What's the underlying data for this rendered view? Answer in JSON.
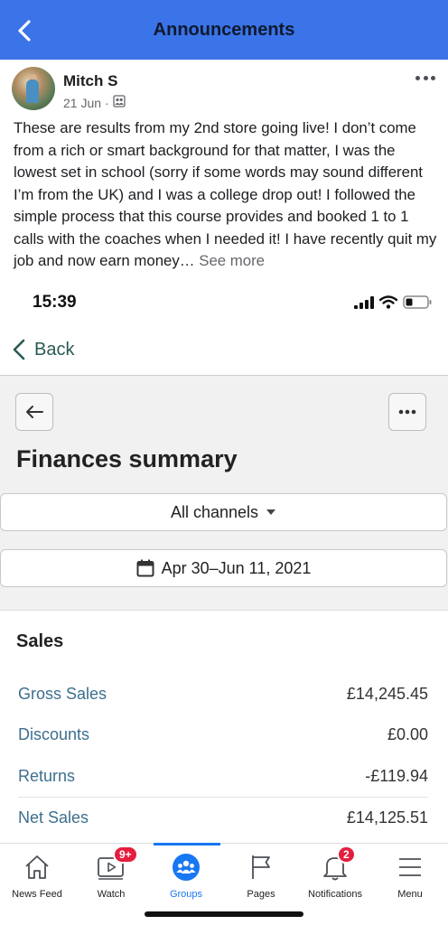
{
  "header": {
    "title": "Announcements",
    "back_icon": "chevron-left-icon",
    "background_color": "#3b73e8"
  },
  "post": {
    "author": "Mitch S",
    "date": "21 Jun",
    "separator": "·",
    "audience_icon": "group-audience-icon",
    "more_icon": "more-horizontal-icon",
    "text": "These are results from my 2nd store going live! I don’t come from a rich or smart background for that matter, I was the lowest set in school (sorry if some words may sound different I’m from the UK) and I was a college drop out! I followed the simple process that this course provides and booked 1 to 1 calls with the coaches when I needed it! I have recently quit my job and now earn money…",
    "see_more": "See more"
  },
  "embedded_screenshot": {
    "status_time": "15:39",
    "back_label": "Back",
    "page_title": "Finances summary",
    "channel_selector": "All channels",
    "date_range": "Apr 30–Jun 11, 2021",
    "sales": {
      "title": "Sales",
      "rows": [
        {
          "label": "Gross Sales",
          "value": "£14,245.45"
        },
        {
          "label": "Discounts",
          "value": "£0.00"
        },
        {
          "label": "Returns",
          "value": "-£119.94"
        },
        {
          "label": "Net Sales",
          "value": "£14,125.51"
        }
      ]
    }
  },
  "bottom_nav": {
    "items": [
      {
        "label": "News Feed",
        "icon": "home-icon"
      },
      {
        "label": "Watch",
        "icon": "video-icon",
        "badge": "9+"
      },
      {
        "label": "Groups",
        "icon": "groups-icon",
        "active": true
      },
      {
        "label": "Pages",
        "icon": "flag-icon"
      },
      {
        "label": "Notifications",
        "icon": "bell-icon",
        "badge": "2"
      },
      {
        "label": "Menu",
        "icon": "menu-icon"
      }
    ],
    "active_color": "#1877f2",
    "badge_color": "#e41e3f"
  }
}
